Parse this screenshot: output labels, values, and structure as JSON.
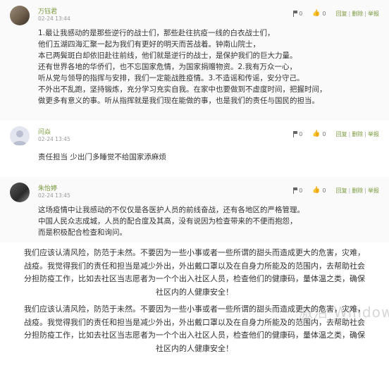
{
  "comments": [
    {
      "user": "万钰君",
      "time": "02-24 13:44",
      "flag_count": "0",
      "like_count": "0",
      "actions": [
        "回复",
        "删除",
        "举报"
      ],
      "lines": [
        "1.最让我感动的是那些逆行的战士们，那些赴往抗疫一线的白衣战士们，",
        "他们五湖四海汇聚一起为我们有更好的明天而苦战着。钟南山院士，",
        "本已两鬓斑白却依旧赴往前线，他们就是逆行的战士，是保护我们的巨大力量。",
        "还有世界各地的华侨们，也不忘国家危情，为国家捐赠物资。2.我有万众一心，",
        "听从党与领导的指挥与安排，我们一定能战胜疫情。3.不造谣和传谣，安分守己。",
        "不外出不乱跑，坚持锻炼，充分学习充实自我。在家中也要做到不虚度时间，把握时间，",
        "做更多有意义的事。听从指挥就是我们现在能做的事，也是我们的责任与国民的担当。"
      ]
    },
    {
      "user": "闫焱",
      "time": "02-24 13:45",
      "flag_count": "0",
      "like_count": "0",
      "actions": [
        "回复",
        "删除",
        "举报"
      ],
      "lines": [
        "责任担当  少出门多睡觉不给国家添麻烦"
      ]
    },
    {
      "user": "朱怡婷",
      "time": "02-24 13:45",
      "flag_count": "0",
      "like_count": "0",
      "actions": [
        "回复",
        "删除",
        "举报"
      ],
      "lines": [
        "这场疫情中让我感动的不仅仅是各医护人员的前线奋战，还有各地区的严格管理。",
        "中国人民众志成城，人员的配合度及其高，没有说因为检查带来的不便而抱怨，",
        "而是积极配合检查和询问。"
      ]
    }
  ],
  "posts": [
    {
      "lines": [
        "我们应该认清风险，防范于未然。不要因为一些小事或者一些所谓的甜头而造成更大的危害，灾难，",
        "战疫。我觉得我们的责任和担当是减少外出，外出戴口罩以及在自身力所能及的范围内，去帮助社会",
        "分担防疫工作，比如去社区当志愿者为一个个出入社区人员，检查他们的健康码，量体温之类，确保",
        "社区内的人健康安全！"
      ]
    },
    {
      "lines": [
        "我们应该认清风险，防范于未然。不要因为一些小事或者一些所谓的甜头而造成更大的危害，灾难，",
        "战疫。我觉得我们的责任和担当是减少外出，外出戴口罩以及在自身力所能及的范围内，去帮助社会",
        "分担防疫工作，比如去社区当志愿者为一个个出入社区人员，检查他们的健康码，量体温之类，确保",
        "社区内的人健康安全！"
      ]
    }
  ],
  "watermark": "激活 Windows",
  "icons": {
    "flag": "report-flag-icon",
    "thumb": "thumbs-up-icon"
  }
}
